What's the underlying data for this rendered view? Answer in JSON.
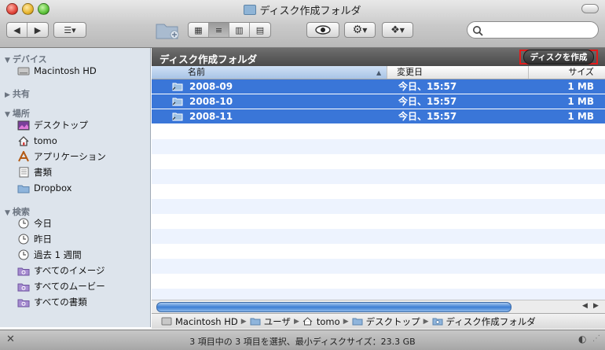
{
  "window": {
    "title": "ディスク作成フォルダ"
  },
  "toolbar": {
    "search_placeholder": "",
    "colors": {
      "accent": "#3a76d8",
      "highlight": "#e31b1b"
    }
  },
  "sidebar": {
    "sections": [
      {
        "label": "デバイス",
        "items": [
          {
            "label": "Macintosh HD",
            "icon": "hard-drive-icon"
          }
        ]
      },
      {
        "label": "共有",
        "items": []
      },
      {
        "label": "場所",
        "items": [
          {
            "label": "デスクトップ",
            "icon": "desktop-icon"
          },
          {
            "label": "tomo",
            "icon": "home-icon"
          },
          {
            "label": "アプリケーション",
            "icon": "applications-icon"
          },
          {
            "label": "書類",
            "icon": "documents-icon"
          },
          {
            "label": "Dropbox",
            "icon": "folder-icon"
          }
        ]
      },
      {
        "label": "検索",
        "items": [
          {
            "label": "今日",
            "icon": "clock-icon"
          },
          {
            "label": "昨日",
            "icon": "clock-icon"
          },
          {
            "label": "過去 1 週間",
            "icon": "clock-icon"
          },
          {
            "label": "すべてのイメージ",
            "icon": "smart-folder-icon"
          },
          {
            "label": "すべてのムービー",
            "icon": "smart-folder-icon"
          },
          {
            "label": "すべての書類",
            "icon": "smart-folder-icon"
          }
        ]
      }
    ]
  },
  "burn_folder": {
    "title": "ディスク作成フォルダ",
    "burn_button": "ディスクを作成"
  },
  "columns": {
    "name": "名前",
    "date": "変更日",
    "size": "サイズ"
  },
  "files": [
    {
      "name": "2008-09",
      "date": "今日、15:57",
      "size": "1 MB",
      "selected": true
    },
    {
      "name": "2008-10",
      "date": "今日、15:57",
      "size": "1 MB",
      "selected": true
    },
    {
      "name": "2008-11",
      "date": "今日、15:57",
      "size": "1 MB",
      "selected": true
    }
  ],
  "path": [
    {
      "label": "Macintosh HD",
      "icon": "hard-drive-icon"
    },
    {
      "label": "ユーザ",
      "icon": "folder-icon"
    },
    {
      "label": "tomo",
      "icon": "home-icon"
    },
    {
      "label": "デスクトップ",
      "icon": "folder-icon"
    },
    {
      "label": "ディスク作成フォルダ",
      "icon": "burn-folder-icon"
    }
  ],
  "status": {
    "text": "3 項目中の 3 項目を選択、最小ディスクサイズ：23.3 GB"
  }
}
